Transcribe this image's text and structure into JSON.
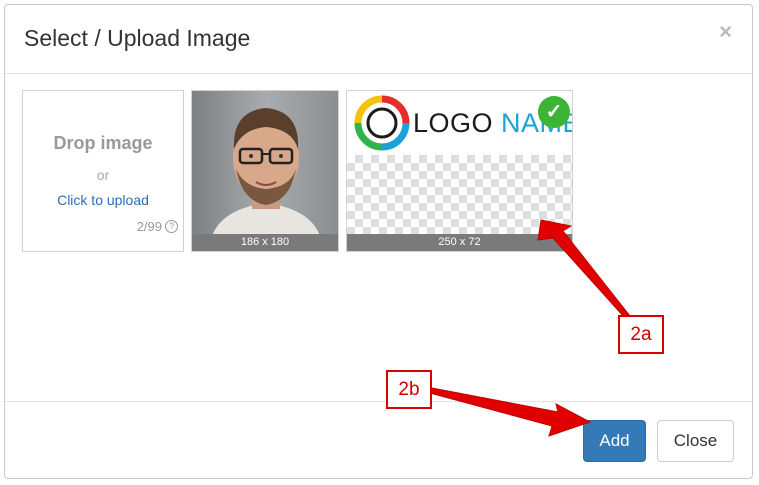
{
  "modal": {
    "title": "Select / Upload Image",
    "close_icon": "×"
  },
  "drop_zone": {
    "title": "Drop image",
    "or": "or",
    "upload_link": "Click to upload",
    "count": "2/99",
    "help_icon": "?"
  },
  "images": [
    {
      "caption": "186 x 180",
      "selected": false
    },
    {
      "caption": "250 x 72",
      "selected": true,
      "logo_word": "LOGO",
      "logo_name": "NAME"
    }
  ],
  "footer": {
    "add_label": "Add",
    "close_label": "Close"
  },
  "annotations": {
    "a": "2a",
    "b": "2b"
  },
  "colors": {
    "primary": "#337ab7",
    "check": "#3db534",
    "annotation": "#d90000"
  }
}
